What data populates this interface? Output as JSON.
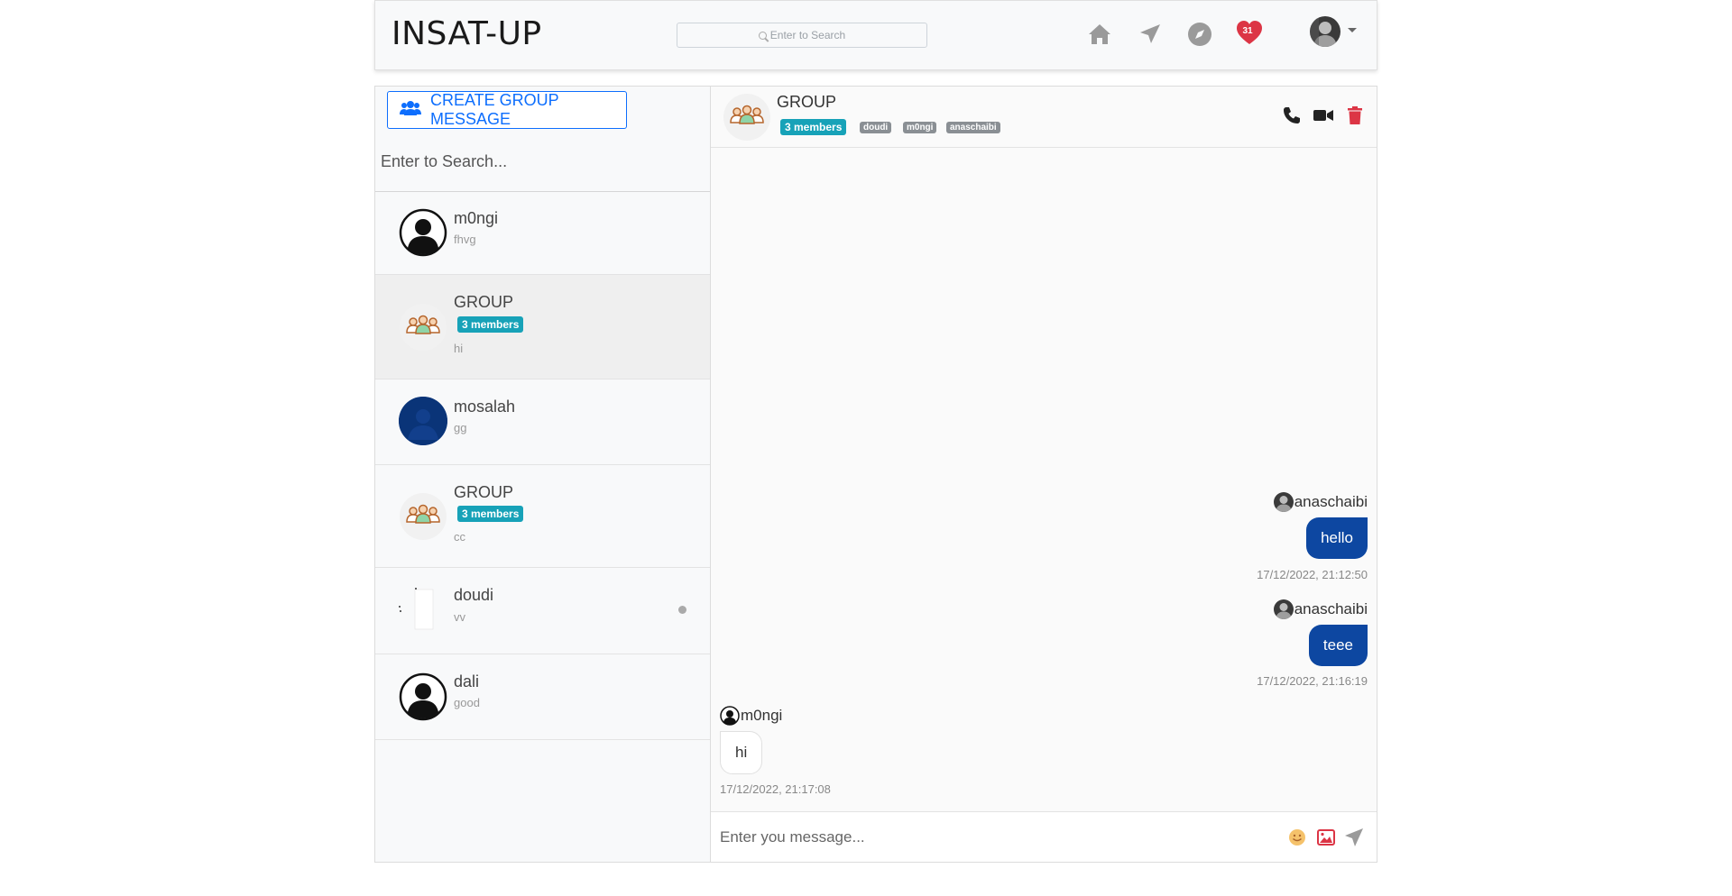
{
  "header": {
    "brand": "INSAT-UP",
    "search_placeholder": "Enter to Search",
    "notification_count": "31"
  },
  "sidebar": {
    "create_group_label": "CREATE GROUP MESSAGE",
    "search_placeholder": "Enter to Search...",
    "conversations": [
      {
        "name": "m0ngi",
        "last": "fhvg"
      },
      {
        "name": "GROUP",
        "badge": "3 members",
        "last": "hi"
      },
      {
        "name": "mosalah",
        "last": "gg"
      },
      {
        "name": "GROUP",
        "badge": "3 members",
        "last": "cc"
      },
      {
        "name": "doudi",
        "last": "vv"
      },
      {
        "name": "dali",
        "last": "good"
      }
    ]
  },
  "chat": {
    "title": "GROUP",
    "members_badge": "3 members",
    "members": [
      "doudi",
      "m0ngi",
      "anaschaibi"
    ],
    "messages": [
      {
        "sender": "anaschaibi",
        "text": "hello",
        "time": "17/12/2022, 21:12:50"
      },
      {
        "sender": "anaschaibi",
        "text": "teee",
        "time": "17/12/2022, 21:16:19"
      },
      {
        "sender": "m0ngi",
        "text": "hi",
        "time": "17/12/2022, 21:17:08"
      }
    ],
    "composer_placeholder": "Enter you message..."
  },
  "colors": {
    "accent": "#0d6efd",
    "bubble_out": "#0d47a1",
    "badge": "#17a2b8",
    "heart": "#dc3545",
    "delete": "#dc3545"
  },
  "icons": [
    "home-icon",
    "send-icon",
    "compass-icon",
    "heart-icon",
    "avatar",
    "users-icon",
    "phone-icon",
    "video-icon",
    "trash-icon",
    "emoji-icon",
    "image-icon"
  ]
}
